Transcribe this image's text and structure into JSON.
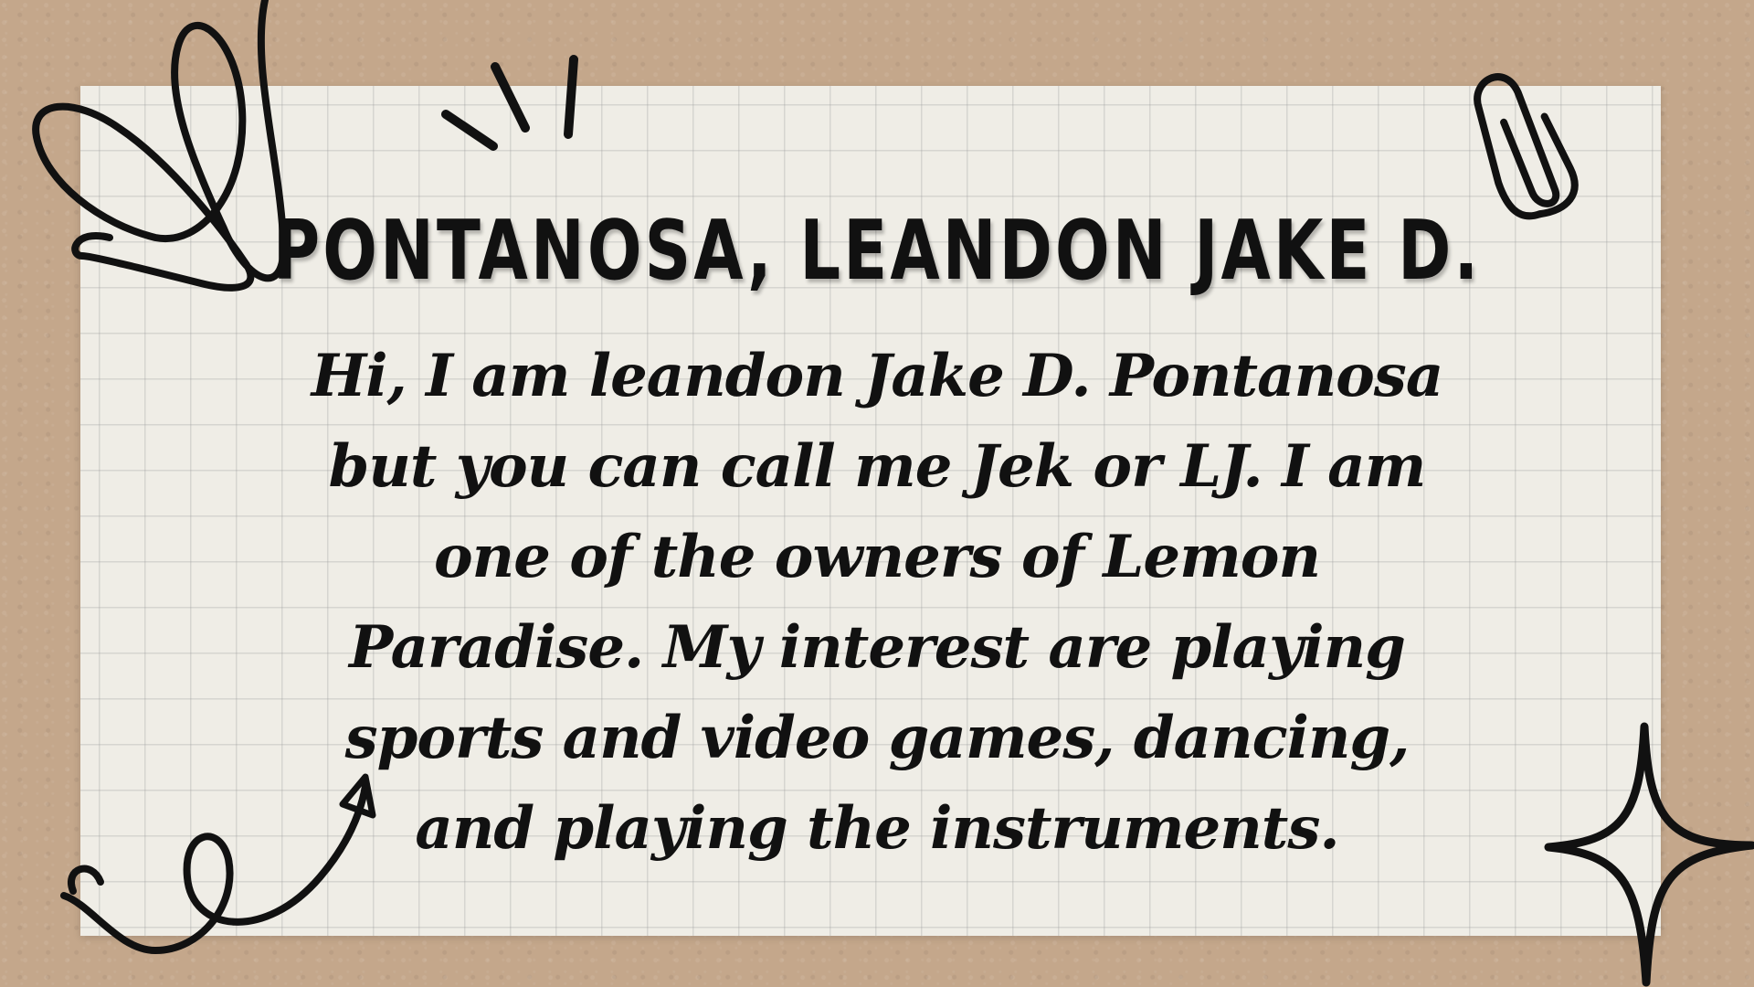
{
  "slide": {
    "title": "PONTANOSA, LEANDON JAKE D.",
    "body": "Hi, I am leandon Jake D. Pontanosa but you can call me Jek or LJ. I am one of the owners of Lemon Paradise. My interest are playing sports and video games, dancing, and playing the instruments."
  },
  "colors": {
    "background": "#c4a78b",
    "paper": "#efede6",
    "ink": "#111111"
  },
  "decorations": [
    "loop-scribble-icon",
    "burst-lines-icon",
    "paperclip-icon",
    "curly-arrow-icon",
    "four-point-star-icon"
  ]
}
